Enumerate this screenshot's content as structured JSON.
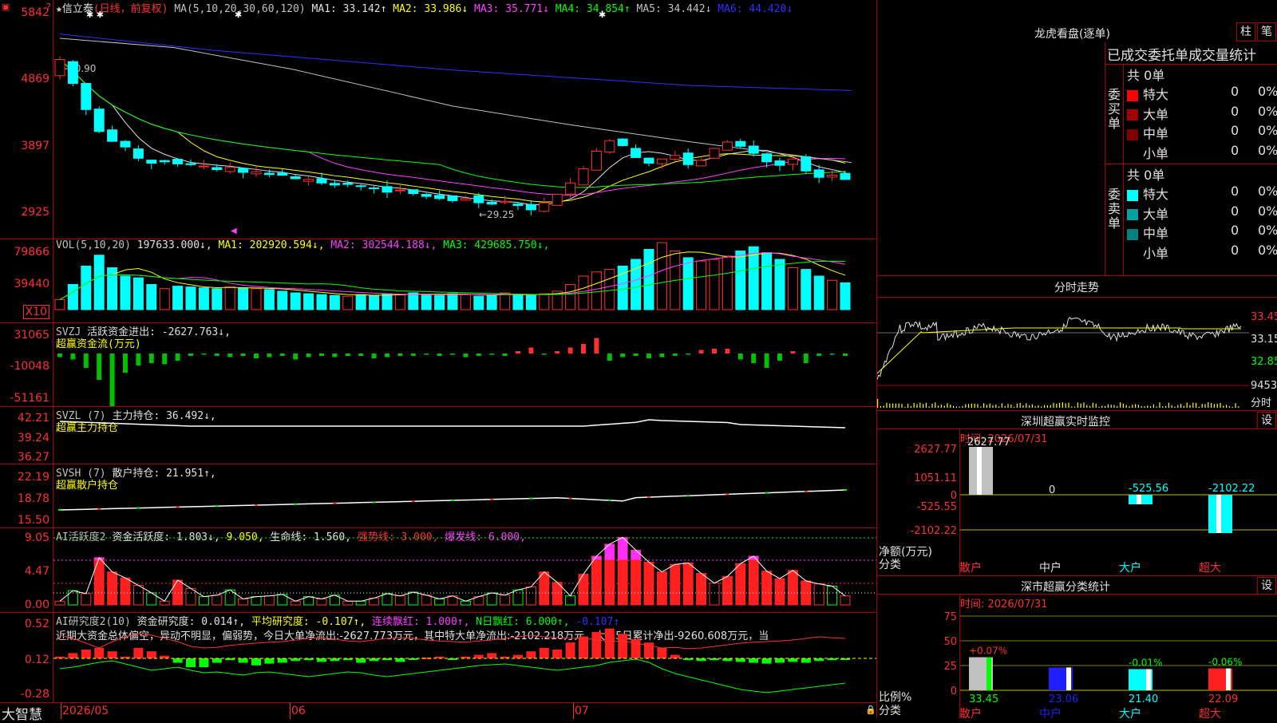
{
  "window": {
    "stock_name": "信立泰",
    "period_label": "(日线，前复权)",
    "bottom_brand": "大智慧",
    "x_axis": [
      "2026/05",
      "06",
      "07"
    ]
  },
  "main_pane": {
    "ma_spec": "MA(5,10,20,30,60,120)",
    "ma_values": [
      {
        "label": "MA1:",
        "value": "33.142",
        "arrow": "↑",
        "color": "#e0e0e0"
      },
      {
        "label": "MA2:",
        "value": "33.986",
        "arrow": "↓",
        "color": "#ffff00"
      },
      {
        "label": "MA3:",
        "value": "35.771",
        "arrow": "↓",
        "color": "#ff40ff"
      },
      {
        "label": "MA4:",
        "value": "34.854",
        "arrow": "↑",
        "color": "#00ff00"
      },
      {
        "label": "MA5:",
        "value": "34.442",
        "arrow": "↓",
        "color": "#c0c0c0"
      },
      {
        "label": "MA6:",
        "value": "44.420",
        "arrow": "↓",
        "color": "#3030ff"
      }
    ],
    "y_labels": [
      "5842",
      "4869",
      "3897",
      "2925"
    ],
    "high_note": "←50.90",
    "low_note": "←29.25"
  },
  "vol_pane": {
    "header": "VOL(5,10,20)",
    "value": "197633.000",
    "ma": [
      {
        "label": "MA1:",
        "value": "202920.594",
        "arrow": "↓",
        "color": "#ffff00"
      },
      {
        "label": "MA2:",
        "value": "302544.188",
        "arrow": "↓",
        "color": "#ff40ff"
      },
      {
        "label": "MA3:",
        "value": "429685.750",
        "arrow": "↓",
        "color": "#00ff00"
      }
    ],
    "y_labels": [
      "79866",
      "39440"
    ],
    "unit": "X10"
  },
  "svzj_pane": {
    "header": "SVZJ",
    "label": "活跃资金进出:",
    "value": "-2627.763↓,",
    "subtitle": "超赢资金流(万元)",
    "y_labels": [
      "31065",
      "-10048",
      "-51161"
    ]
  },
  "svzl_pane": {
    "header": "SVZL (7)",
    "label": "主力持仓:",
    "value": "36.492↓,",
    "subtitle": "超赢主力持仓",
    "y_labels": [
      "42.21",
      "39.24",
      "36.27"
    ]
  },
  "svsh_pane": {
    "header": "SVSH (7)",
    "label": "散户持仓:",
    "value": "21.951↑,",
    "subtitle": "超赢散户持仓",
    "y_labels": [
      "22.19",
      "18.78",
      "15.50"
    ]
  },
  "ai1_pane": {
    "header": "AI活跃度2",
    "items": [
      {
        "text": "资金活跃度: 1.803↓,",
        "color": "#e0e0e0"
      },
      {
        "text": "9.050,",
        "color": "#ffff00"
      },
      {
        "text": "生命线: 1.560,",
        "color": "#e0e0e0"
      },
      {
        "text": "强势线: 3.000,",
        "color": "#ff3030"
      },
      {
        "text": "爆发线: 6.000,",
        "color": "#ff40ff"
      }
    ],
    "y_labels": [
      "9.05",
      "4.47",
      "0.00"
    ]
  },
  "ai2_pane": {
    "header": "AI研究度2(10)",
    "items": [
      {
        "text": "资金研究度: 0.014↑,",
        "color": "#e0e0e0"
      },
      {
        "text": "平均研究度: -0.107↑,",
        "color": "#ffff00"
      },
      {
        "text": "连续飘红: 1.000↑,",
        "color": "#ff40ff"
      },
      {
        "text": "N日飘红: 6.000↑,",
        "color": "#00ff00"
      },
      {
        "text": "-0.107↑",
        "color": "#3030ff"
      }
    ],
    "comment": "近期大资金总体偏空，异动不明显，偏弱势，今日大单净流出:-2627.773万元，其中特大单净流出:-2102.218万元，大单5日累计净出-9260.608万元，当",
    "y_labels": [
      "0.52",
      "0.12",
      "-0.28"
    ]
  },
  "dragon_panel": {
    "title": "龙虎看盘(逐单)",
    "btn_bar": "柱",
    "btn_pen": "笔",
    "subtitle": "已成交委托单成交量统计",
    "buy_label": "委买单",
    "sell_label": "委卖单",
    "buy_total": "共 0单",
    "sell_total": "共 0单",
    "buy_rows": [
      {
        "name": "特大",
        "count": "0",
        "pct": "0%",
        "color": "#ff0000"
      },
      {
        "name": "大单",
        "count": "0",
        "pct": "0%",
        "color": "#a00000"
      },
      {
        "name": "中单",
        "count": "0",
        "pct": "0%",
        "color": "#800000"
      },
      {
        "name": "小单",
        "count": "0",
        "pct": "0%",
        "color": "#000000"
      }
    ],
    "sell_rows": [
      {
        "name": "特大",
        "count": "0",
        "pct": "0%",
        "color": "#00ffff"
      },
      {
        "name": "大单",
        "count": "0",
        "pct": "0%",
        "color": "#00a0a0"
      },
      {
        "name": "中单",
        "count": "0",
        "pct": "0%",
        "color": "#008080"
      },
      {
        "name": "小单",
        "count": "0",
        "pct": "0%",
        "color": "#000000"
      }
    ]
  },
  "intraday_panel": {
    "title": "分时走势",
    "y_labels": [
      "33.45",
      "33.15",
      "32.85"
    ],
    "vol_label": "9453",
    "vol_unit": "分时"
  },
  "sz_monitor": {
    "title": "深圳超赢实时监控",
    "settings": "设",
    "date": "时间: 2026/07/31",
    "y_labels": [
      "2627.77",
      "1051.11",
      "0",
      "-525.55",
      "-2102.22"
    ],
    "unit_a": "净额(万元)",
    "unit_b": "分类",
    "categories": [
      "散户",
      "中户",
      "大户",
      "超大"
    ],
    "values": [
      2627.77,
      0,
      -525.56,
      -2102.22
    ],
    "value_labels": [
      "2627.77",
      "0",
      "-525.56",
      "-2102.22"
    ]
  },
  "sz_stats": {
    "title": "深市超赢分类统计",
    "settings": "设",
    "date": "时间: 2026/07/31",
    "y_labels": [
      "75",
      "50",
      "25",
      "0"
    ],
    "unit_a": "比例%",
    "unit_b": "分类",
    "categories": [
      "散户",
      "中户",
      "大户",
      "超大"
    ],
    "top_labels": [
      "+0.07%",
      "",
      "-0.01%",
      "-0.06%"
    ],
    "bottom_values": [
      "33.45",
      "23.06",
      "21.40",
      "22.09"
    ]
  }
}
